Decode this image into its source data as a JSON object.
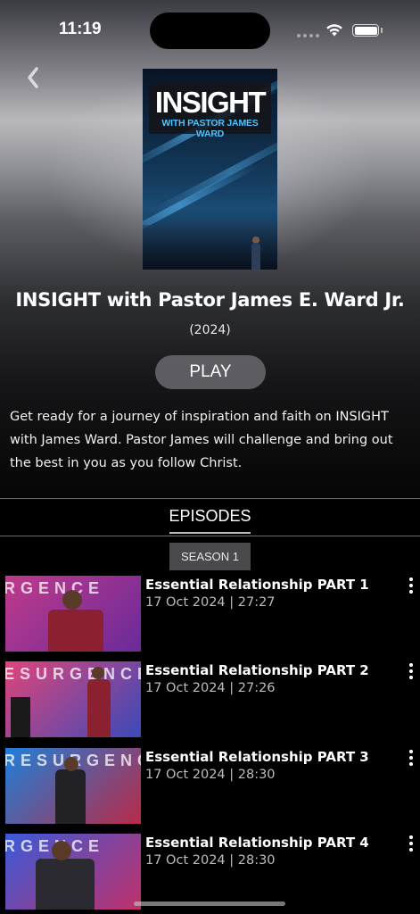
{
  "status_bar": {
    "time": "11:19"
  },
  "show": {
    "poster_title": "INSIGHT",
    "poster_subtitle": "WITH PASTOR JAMES WARD",
    "title": "INSIGHT with Pastor James E. Ward Jr.",
    "year": "(2024)",
    "play_label": "PLAY",
    "description": "Get ready for a journey of inspiration and faith on INSIGHT with James Ward. Pastor James will challenge and bring out the best in you as you follow Christ."
  },
  "tabs": {
    "episodes_label": "EPISODES"
  },
  "season": {
    "label": "SEASON 1"
  },
  "episodes": [
    {
      "title": "Essential Relationship PART 1",
      "meta": "17 Oct 2024 | 27:27",
      "banner": "RGENCE",
      "colors": [
        "#c03a8a",
        "#6a2a9a"
      ]
    },
    {
      "title": "Essential Relationship PART 2",
      "meta": "17 Oct 2024 | 27:26",
      "banner": "ESURGENCE",
      "colors": [
        "#e0447a",
        "#3a4ab8"
      ]
    },
    {
      "title": "Essential Relationship PART 3",
      "meta": "17 Oct 2024 | 28:30",
      "banner": "RESURGENCE",
      "colors": [
        "#1e7fd8",
        "#b82a48"
      ]
    },
    {
      "title": "Essential Relationship PART 4",
      "meta": "17 Oct 2024 | 28:30",
      "banner": "RGENCE",
      "colors": [
        "#3a5ad8",
        "#c0306a"
      ]
    }
  ]
}
